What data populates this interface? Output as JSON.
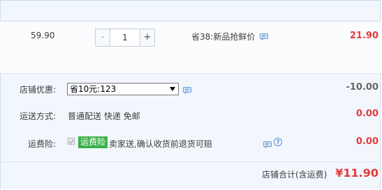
{
  "item": {
    "price": "59.90",
    "quantity_minus": "-",
    "quantity": "1",
    "quantity_plus": "+",
    "promotion": "省38:新品抢鲜价",
    "total": "21.90"
  },
  "shop_discount": {
    "label": "店铺优惠:",
    "selected_option": "省10元:123",
    "value": "-10.00"
  },
  "shipping": {
    "label": "运送方式:",
    "method": "普通配送 快递 免邮",
    "value": "0.00"
  },
  "freight_insurance": {
    "label": "运费险:",
    "checked": true,
    "tag": "运费险",
    "description": "卖家送,确认收货前退货可赔",
    "value": "0.00",
    "help_symbol": "?"
  },
  "summary": {
    "label": "店铺合计(含运费)",
    "total": "¥11.90"
  },
  "colors": {
    "accent_red": "#e4393c",
    "tag_green": "#3bb04a",
    "link_blue": "#5b8ed6",
    "panel_bg": "#f2f7fd"
  },
  "icons": {
    "chat": "chat-bubble-icon",
    "help": "question-circle-icon",
    "dropdown": "chevron-down-icon"
  }
}
